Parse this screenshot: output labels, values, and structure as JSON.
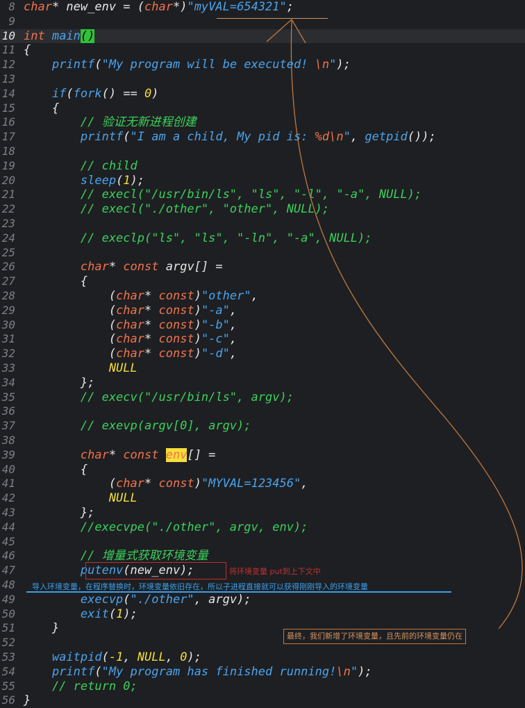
{
  "editor": {
    "lines": [
      {
        "n": "8",
        "current": false,
        "tokens": [
          {
            "t": "char",
            "c": "kw"
          },
          {
            "t": "* new_env = (",
            "c": "id"
          },
          {
            "t": "char",
            "c": "kw"
          },
          {
            "t": "*)",
            "c": "id"
          },
          {
            "t": "\"myVAL=654321\"",
            "c": "str"
          },
          {
            "t": ";",
            "c": "p"
          }
        ]
      },
      {
        "n": "9",
        "current": false,
        "tokens": []
      },
      {
        "n": "10",
        "current": true,
        "tokens": [
          {
            "t": "int ",
            "c": "kw"
          },
          {
            "t": "main",
            "c": "fn"
          },
          {
            "t": "()",
            "c": "hlg"
          }
        ]
      },
      {
        "n": "11",
        "current": false,
        "tokens": [
          {
            "t": "{",
            "c": "p"
          }
        ]
      },
      {
        "n": "12",
        "current": false,
        "tokens": [
          {
            "t": "    printf",
            "c": "fn"
          },
          {
            "t": "(",
            "c": "p"
          },
          {
            "t": "\"My program will be executed! ",
            "c": "str"
          },
          {
            "t": "\\n",
            "c": "esc"
          },
          {
            "t": "\"",
            "c": "str"
          },
          {
            "t": ");",
            "c": "p"
          }
        ]
      },
      {
        "n": "13",
        "current": false,
        "tokens": []
      },
      {
        "n": "14",
        "current": false,
        "tokens": [
          {
            "t": "    if",
            "c": "fn"
          },
          {
            "t": "(",
            "c": "p"
          },
          {
            "t": "fork",
            "c": "fn"
          },
          {
            "t": "() == ",
            "c": "p"
          },
          {
            "t": "0",
            "c": "num"
          },
          {
            "t": ")",
            "c": "p"
          }
        ]
      },
      {
        "n": "15",
        "current": false,
        "tokens": [
          {
            "t": "    {",
            "c": "p"
          }
        ]
      },
      {
        "n": "16",
        "current": false,
        "tokens": [
          {
            "t": "        // 验证无新进程创建",
            "c": "cmt"
          }
        ]
      },
      {
        "n": "17",
        "current": false,
        "tokens": [
          {
            "t": "        printf",
            "c": "fn"
          },
          {
            "t": "(",
            "c": "p"
          },
          {
            "t": "\"I am a child, My pid is: ",
            "c": "str"
          },
          {
            "t": "%d\\n",
            "c": "esc"
          },
          {
            "t": "\"",
            "c": "str"
          },
          {
            "t": ", ",
            "c": "p"
          },
          {
            "t": "getpid",
            "c": "fn"
          },
          {
            "t": "());",
            "c": "p"
          }
        ]
      },
      {
        "n": "18",
        "current": false,
        "tokens": []
      },
      {
        "n": "19",
        "current": false,
        "tokens": [
          {
            "t": "        // child",
            "c": "cmt"
          }
        ]
      },
      {
        "n": "20",
        "current": false,
        "tokens": [
          {
            "t": "        sleep",
            "c": "fn"
          },
          {
            "t": "(",
            "c": "p"
          },
          {
            "t": "1",
            "c": "num"
          },
          {
            "t": ");",
            "c": "p"
          }
        ]
      },
      {
        "n": "21",
        "current": false,
        "tokens": [
          {
            "t": "        // execl(\"/usr/bin/ls\", \"ls\", \"-l\", \"-a\", NULL);",
            "c": "cmt"
          }
        ]
      },
      {
        "n": "22",
        "current": false,
        "tokens": [
          {
            "t": "        // execl(\"./other\", \"other\", NULL);",
            "c": "cmt"
          }
        ]
      },
      {
        "n": "23",
        "current": false,
        "tokens": []
      },
      {
        "n": "24",
        "current": false,
        "tokens": [
          {
            "t": "        // execlp(\"ls\", \"ls\", \"-ln\", \"-a\", NULL);",
            "c": "cmt"
          }
        ]
      },
      {
        "n": "25",
        "current": false,
        "tokens": []
      },
      {
        "n": "26",
        "current": false,
        "tokens": [
          {
            "t": "        char",
            "c": "kw"
          },
          {
            "t": "* ",
            "c": "id"
          },
          {
            "t": "const",
            "c": "kw"
          },
          {
            "t": " argv[] =",
            "c": "id"
          }
        ]
      },
      {
        "n": "27",
        "current": false,
        "tokens": [
          {
            "t": "        {",
            "c": "p"
          }
        ]
      },
      {
        "n": "28",
        "current": false,
        "tokens": [
          {
            "t": "            (",
            "c": "p"
          },
          {
            "t": "char",
            "c": "kw"
          },
          {
            "t": "* ",
            "c": "id"
          },
          {
            "t": "const",
            "c": "kw"
          },
          {
            "t": ")",
            "c": "p"
          },
          {
            "t": "\"other\"",
            "c": "str"
          },
          {
            "t": ",",
            "c": "p"
          }
        ]
      },
      {
        "n": "29",
        "current": false,
        "tokens": [
          {
            "t": "            (",
            "c": "p"
          },
          {
            "t": "char",
            "c": "kw"
          },
          {
            "t": "* ",
            "c": "id"
          },
          {
            "t": "const",
            "c": "kw"
          },
          {
            "t": ")",
            "c": "p"
          },
          {
            "t": "\"-a\"",
            "c": "str"
          },
          {
            "t": ",",
            "c": "p"
          }
        ]
      },
      {
        "n": "30",
        "current": false,
        "tokens": [
          {
            "t": "            (",
            "c": "p"
          },
          {
            "t": "char",
            "c": "kw"
          },
          {
            "t": "* ",
            "c": "id"
          },
          {
            "t": "const",
            "c": "kw"
          },
          {
            "t": ")",
            "c": "p"
          },
          {
            "t": "\"-b\"",
            "c": "str"
          },
          {
            "t": ",",
            "c": "p"
          }
        ]
      },
      {
        "n": "31",
        "current": false,
        "tokens": [
          {
            "t": "            (",
            "c": "p"
          },
          {
            "t": "char",
            "c": "kw"
          },
          {
            "t": "* ",
            "c": "id"
          },
          {
            "t": "const",
            "c": "kw"
          },
          {
            "t": ")",
            "c": "p"
          },
          {
            "t": "\"-c\"",
            "c": "str"
          },
          {
            "t": ",",
            "c": "p"
          }
        ]
      },
      {
        "n": "32",
        "current": false,
        "tokens": [
          {
            "t": "            (",
            "c": "p"
          },
          {
            "t": "char",
            "c": "kw"
          },
          {
            "t": "* ",
            "c": "id"
          },
          {
            "t": "const",
            "c": "kw"
          },
          {
            "t": ")",
            "c": "p"
          },
          {
            "t": "\"-d\"",
            "c": "str"
          },
          {
            "t": ",",
            "c": "p"
          }
        ]
      },
      {
        "n": "33",
        "current": false,
        "tokens": [
          {
            "t": "            NULL",
            "c": "num"
          }
        ]
      },
      {
        "n": "34",
        "current": false,
        "tokens": [
          {
            "t": "        };",
            "c": "p"
          }
        ]
      },
      {
        "n": "35",
        "current": false,
        "tokens": [
          {
            "t": "        // execv(\"/usr/bin/ls\", argv);",
            "c": "cmt"
          }
        ]
      },
      {
        "n": "36",
        "current": false,
        "tokens": []
      },
      {
        "n": "37",
        "current": false,
        "tokens": [
          {
            "t": "        // exevp(argv[0], argv);",
            "c": "cmt"
          }
        ]
      },
      {
        "n": "38",
        "current": false,
        "tokens": []
      },
      {
        "n": "39",
        "current": false,
        "tokens": [
          {
            "t": "        char",
            "c": "kw"
          },
          {
            "t": "* ",
            "c": "id"
          },
          {
            "t": "const",
            "c": "kw"
          },
          {
            "t": " ",
            "c": "id"
          },
          {
            "t": "env",
            "c": "hly"
          },
          {
            "t": "[] =",
            "c": "id"
          }
        ]
      },
      {
        "n": "40",
        "current": false,
        "tokens": [
          {
            "t": "        {",
            "c": "p"
          }
        ]
      },
      {
        "n": "41",
        "current": false,
        "tokens": [
          {
            "t": "            (",
            "c": "p"
          },
          {
            "t": "char",
            "c": "kw"
          },
          {
            "t": "* ",
            "c": "id"
          },
          {
            "t": "const",
            "c": "kw"
          },
          {
            "t": ")",
            "c": "p"
          },
          {
            "t": "\"MYVAL=123456\"",
            "c": "str"
          },
          {
            "t": ",",
            "c": "p"
          }
        ]
      },
      {
        "n": "42",
        "current": false,
        "tokens": [
          {
            "t": "            NULL",
            "c": "num"
          }
        ]
      },
      {
        "n": "43",
        "current": false,
        "tokens": [
          {
            "t": "        };",
            "c": "p"
          }
        ]
      },
      {
        "n": "44",
        "current": false,
        "tokens": [
          {
            "t": "        //execvpe(\"./other\", argv, env);",
            "c": "cmt"
          }
        ]
      },
      {
        "n": "45",
        "current": false,
        "tokens": []
      },
      {
        "n": "46",
        "current": false,
        "tokens": [
          {
            "t": "        // 增量式获取环境变量",
            "c": "cmt"
          }
        ]
      },
      {
        "n": "47",
        "current": false,
        "tokens": [
          {
            "t": "        putenv",
            "c": "fn"
          },
          {
            "t": "(new_env);",
            "c": "p"
          }
        ]
      },
      {
        "n": "48",
        "current": false,
        "tokens": []
      },
      {
        "n": "49",
        "current": false,
        "tokens": [
          {
            "t": "        execvp",
            "c": "fn"
          },
          {
            "t": "(",
            "c": "p"
          },
          {
            "t": "\"./other\"",
            "c": "str"
          },
          {
            "t": ", argv);",
            "c": "p"
          }
        ]
      },
      {
        "n": "50",
        "current": false,
        "tokens": [
          {
            "t": "        exit",
            "c": "fn"
          },
          {
            "t": "(",
            "c": "p"
          },
          {
            "t": "1",
            "c": "num"
          },
          {
            "t": ");",
            "c": "p"
          }
        ]
      },
      {
        "n": "51",
        "current": false,
        "tokens": [
          {
            "t": "    }",
            "c": "p"
          }
        ]
      },
      {
        "n": "52",
        "current": false,
        "tokens": []
      },
      {
        "n": "53",
        "current": false,
        "tokens": [
          {
            "t": "    waitpid",
            "c": "fn"
          },
          {
            "t": "(",
            "c": "p"
          },
          {
            "t": "-1",
            "c": "num"
          },
          {
            "t": ", ",
            "c": "p"
          },
          {
            "t": "NULL",
            "c": "num"
          },
          {
            "t": ", ",
            "c": "p"
          },
          {
            "t": "0",
            "c": "num"
          },
          {
            "t": ");",
            "c": "p"
          }
        ]
      },
      {
        "n": "54",
        "current": false,
        "tokens": [
          {
            "t": "    printf",
            "c": "fn"
          },
          {
            "t": "(",
            "c": "p"
          },
          {
            "t": "\"My program has finished running!",
            "c": "str"
          },
          {
            "t": "\\n",
            "c": "esc"
          },
          {
            "t": "\"",
            "c": "str"
          },
          {
            "t": ");",
            "c": "p"
          }
        ]
      },
      {
        "n": "55",
        "current": false,
        "tokens": [
          {
            "t": "    // return 0;",
            "c": "cmt"
          }
        ]
      },
      {
        "n": "56",
        "current": false,
        "tokens": [
          {
            "t": "}",
            "c": "p"
          }
        ]
      }
    ]
  },
  "annotations": {
    "putenv_note": "将环境变量 put到上下文中",
    "import_note": "导入环境变量，在程序替换时，环境变量依旧存在，所以子进程直接就可以获得刚刚导入的环境变量",
    "final_note": "最终，我们新增了环境变量，且先前的环境变量仍在"
  },
  "colors": {
    "background": "#1e1f22",
    "keyword": "#f2734c",
    "function": "#49a4ef",
    "comment": "#3ad25c",
    "number": "#f5df3a",
    "annotation_red": "#c03030",
    "annotation_blue": "#3aa0ee",
    "annotation_orange": "#d39460"
  }
}
